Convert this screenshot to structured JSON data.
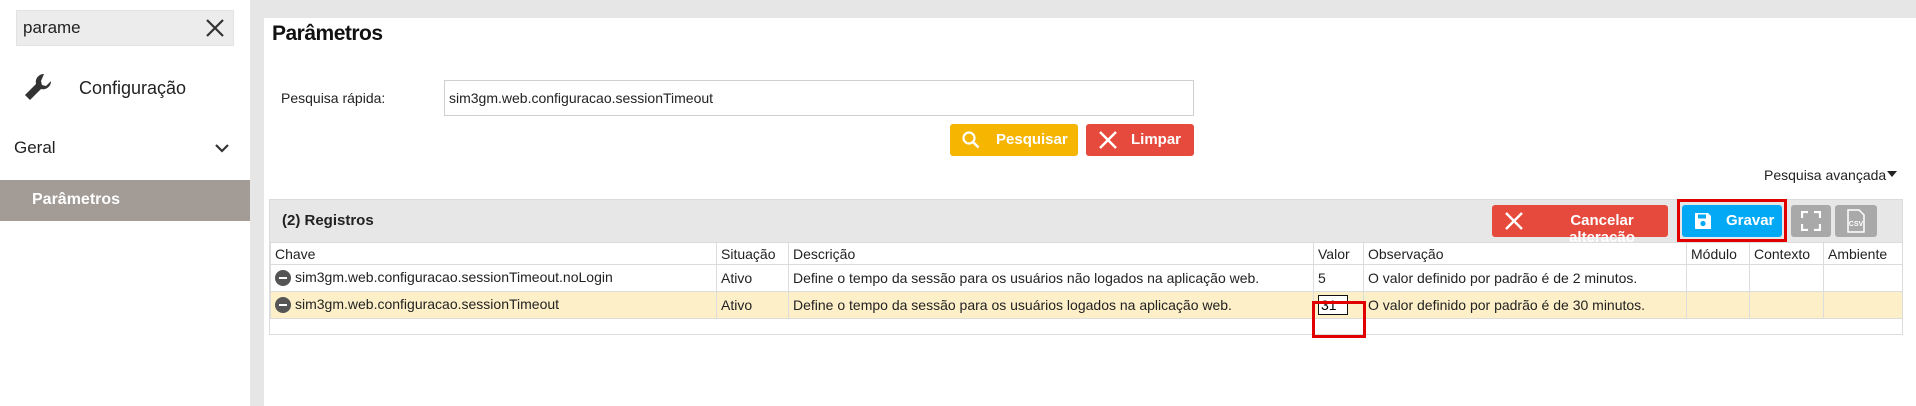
{
  "sidebar": {
    "search_value": "parame",
    "config_label": "Configuração",
    "geral_label": "Geral",
    "parametros_label": "Parâmetros"
  },
  "page": {
    "title": "Parâmetros",
    "quick_search_label": "Pesquisa rápida:",
    "quick_search_value": "sim3gm.web.configuracao.sessionTimeout",
    "btn_pesquisar": "Pesquisar",
    "btn_limpar": "Limpar",
    "advanced_search": "Pesquisa avançada"
  },
  "grid": {
    "records_label": "(2) Registros",
    "btn_cancelar": "Cancelar alteração",
    "btn_gravar": "Gravar",
    "btn_csv": "CSV",
    "columns": [
      "Chave",
      "Situação",
      "Descrição",
      "Valor",
      "Observação",
      "Módulo",
      "Contexto",
      "Ambiente"
    ],
    "rows": [
      {
        "chave": "sim3gm.web.configuracao.sessionTimeout.noLogin",
        "situacao": "Ativo",
        "descricao": "Define o tempo da sessão para os usuários não logados na aplicação web.",
        "valor": "5",
        "observacao": "O valor definido por padrão é de 2 minutos.",
        "modulo": "",
        "contexto": "",
        "ambiente": ""
      },
      {
        "chave": "sim3gm.web.configuracao.sessionTimeout",
        "situacao": "Ativo",
        "descricao": "Define o tempo da sessão para os usuários logados na aplicação web.",
        "valor": "31",
        "observacao": "O valor definido por padrão é de 30 minutos.",
        "modulo": "",
        "contexto": "",
        "ambiente": ""
      }
    ]
  },
  "colors": {
    "pesquisar": "#f5b500",
    "limpar": "#e64a3c",
    "gravar": "#03a9f4",
    "selected_row": "#fdf0c8",
    "highlight": "#e00000"
  }
}
